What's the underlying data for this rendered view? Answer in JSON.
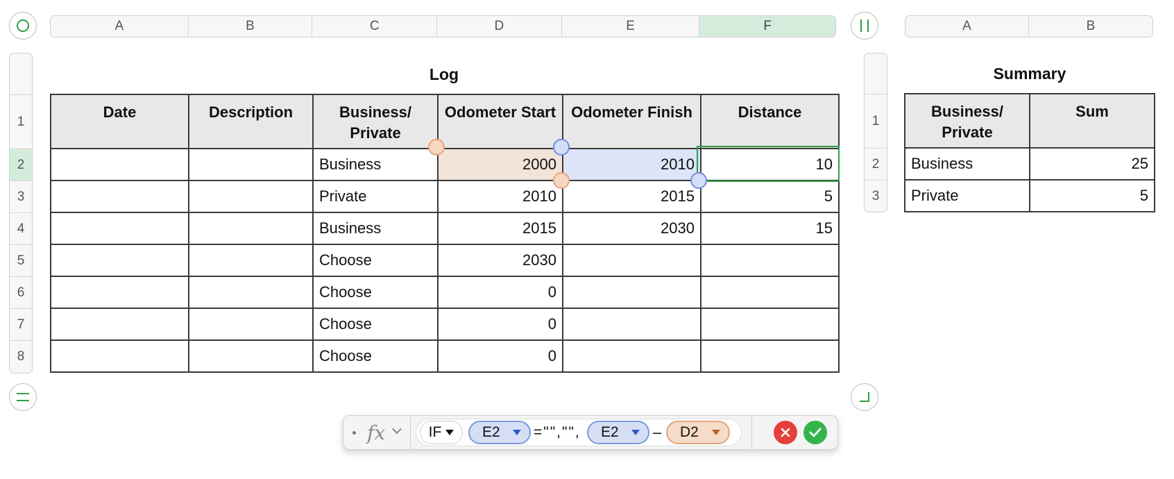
{
  "sheet_left": {
    "columns": [
      "A",
      "B",
      "C",
      "D",
      "E",
      "F"
    ],
    "selected_column": "F",
    "rows": [
      "1",
      "2",
      "3",
      "4",
      "5",
      "6",
      "7",
      "8"
    ],
    "title": "Log",
    "headers": [
      "Date",
      "Description",
      "Business/ Private",
      "Odometer Start",
      "Odometer Finish",
      "Distance"
    ],
    "data": [
      [
        "",
        "",
        "Business",
        "2000",
        "2010",
        "10"
      ],
      [
        "",
        "",
        "Private",
        "2010",
        "2015",
        "5"
      ],
      [
        "",
        "",
        "Business",
        "2015",
        "2030",
        "15"
      ],
      [
        "",
        "",
        "Choose",
        "2030",
        "",
        ""
      ],
      [
        "",
        "",
        "Choose",
        "0",
        "",
        ""
      ],
      [
        "",
        "",
        "Choose",
        "0",
        "",
        ""
      ],
      [
        "",
        "",
        "Choose",
        "0",
        "",
        ""
      ]
    ]
  },
  "sheet_right": {
    "columns": [
      "A",
      "B"
    ],
    "rows": [
      "1",
      "2",
      "3"
    ],
    "title": "Summary",
    "headers": [
      "Business/ Private",
      "Sum"
    ],
    "data": [
      [
        "Business",
        "25"
      ],
      [
        "Private",
        "5"
      ]
    ]
  },
  "formula_bar": {
    "fx_label": "fx",
    "function": "IF",
    "ref1": "E2",
    "literal": "=\"\",\"\",",
    "ref2": "E2",
    "operator": "–",
    "ref3": "D2"
  },
  "colors": {
    "selection_green": "#2f9e44",
    "ref_blue": "#7d98df",
    "ref_orange": "#e0a37b",
    "cancel_red": "#e5403b",
    "accept_green": "#34b44a"
  }
}
